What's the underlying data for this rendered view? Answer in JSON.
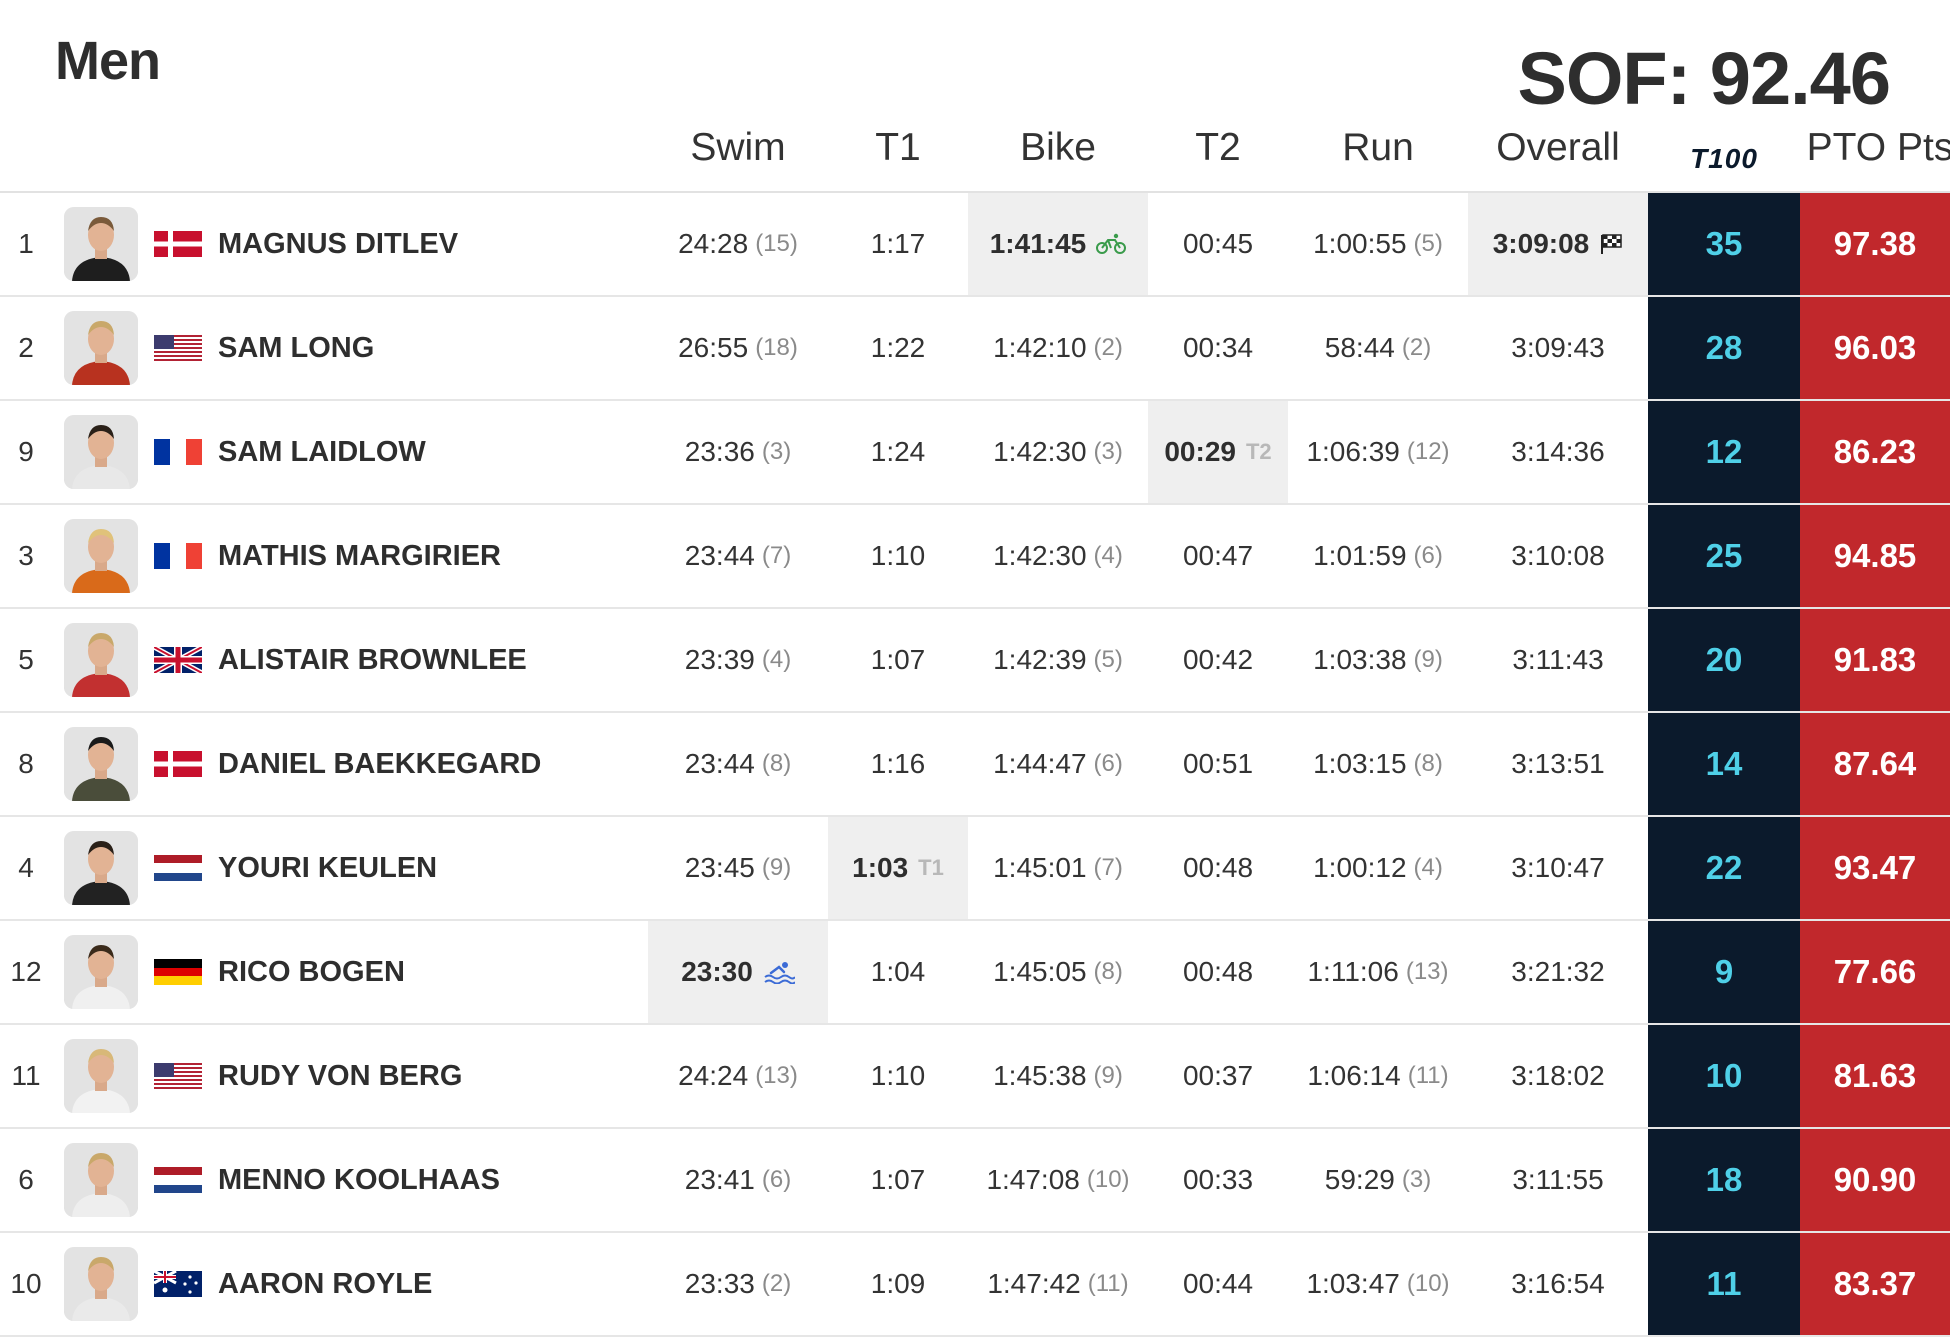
{
  "title": "Men",
  "sof": "SOF: 92.46",
  "headers": {
    "swim": "Swim",
    "t1": "T1",
    "bike": "Bike",
    "t2": "T2",
    "run": "Run",
    "overall": "Overall",
    "t100": "T100",
    "pto": "PTO Pts"
  },
  "colors": {
    "t100_bg": "#0b1a2c",
    "t100_text": "#4fd0e8",
    "pto_bg": "#c1282c",
    "best_bg": "#efefef",
    "bike_icon": "#3a9b4b",
    "swim_icon": "#3b6bd6"
  },
  "rows": [
    {
      "rank": "1",
      "name": "MAGNUS DITLEV",
      "flag": "denmark",
      "swim": "24:28",
      "swim_rank": "(15)",
      "t1": "1:17",
      "bike": "1:41:45",
      "bike_rank": "",
      "t2": "00:45",
      "run": "1:00:55",
      "run_rank": "(5)",
      "overall": "3:09:08",
      "t100": "35",
      "pto": "97.38",
      "best": "bike,overall"
    },
    {
      "rank": "2",
      "name": "SAM LONG",
      "flag": "usa",
      "swim": "26:55",
      "swim_rank": "(18)",
      "t1": "1:22",
      "bike": "1:42:10",
      "bike_rank": "(2)",
      "t2": "00:34",
      "run": "58:44",
      "run_rank": "(2)",
      "overall": "3:09:43",
      "t100": "28",
      "pto": "96.03",
      "best": ""
    },
    {
      "rank": "9",
      "name": "SAM LAIDLOW",
      "flag": "france",
      "swim": "23:36",
      "swim_rank": "(3)",
      "t1": "1:24",
      "bike": "1:42:30",
      "bike_rank": "(3)",
      "t2": "00:29",
      "t2_tag": "T2",
      "run": "1:06:39",
      "run_rank": "(12)",
      "overall": "3:14:36",
      "t100": "12",
      "pto": "86.23",
      "best": "t2"
    },
    {
      "rank": "3",
      "name": "MATHIS MARGIRIER",
      "flag": "france",
      "swim": "23:44",
      "swim_rank": "(7)",
      "t1": "1:10",
      "bike": "1:42:30",
      "bike_rank": "(4)",
      "t2": "00:47",
      "run": "1:01:59",
      "run_rank": "(6)",
      "overall": "3:10:08",
      "t100": "25",
      "pto": "94.85",
      "best": ""
    },
    {
      "rank": "5",
      "name": "ALISTAIR BROWNLEE",
      "flag": "uk",
      "swim": "23:39",
      "swim_rank": "(4)",
      "t1": "1:07",
      "bike": "1:42:39",
      "bike_rank": "(5)",
      "t2": "00:42",
      "run": "1:03:38",
      "run_rank": "(9)",
      "overall": "3:11:43",
      "t100": "20",
      "pto": "91.83",
      "best": ""
    },
    {
      "rank": "8",
      "name": "DANIEL BAEKKEGARD",
      "flag": "denmark",
      "swim": "23:44",
      "swim_rank": "(8)",
      "t1": "1:16",
      "bike": "1:44:47",
      "bike_rank": "(6)",
      "t2": "00:51",
      "run": "1:03:15",
      "run_rank": "(8)",
      "overall": "3:13:51",
      "t100": "14",
      "pto": "87.64",
      "best": ""
    },
    {
      "rank": "4",
      "name": "YOURI KEULEN",
      "flag": "netherlands",
      "swim": "23:45",
      "swim_rank": "(9)",
      "t1": "1:03",
      "t1_tag": "T1",
      "bike": "1:45:01",
      "bike_rank": "(7)",
      "t2": "00:48",
      "run": "1:00:12",
      "run_rank": "(4)",
      "overall": "3:10:47",
      "t100": "22",
      "pto": "93.47",
      "best": "t1"
    },
    {
      "rank": "12",
      "name": "RICO BOGEN",
      "flag": "germany",
      "swim": "23:30",
      "swim_rank": "",
      "t1": "1:04",
      "bike": "1:45:05",
      "bike_rank": "(8)",
      "t2": "00:48",
      "run": "1:11:06",
      "run_rank": "(13)",
      "overall": "3:21:32",
      "t100": "9",
      "pto": "77.66",
      "best": "swim"
    },
    {
      "rank": "11",
      "name": "RUDY VON BERG",
      "flag": "usa",
      "swim": "24:24",
      "swim_rank": "(13)",
      "t1": "1:10",
      "bike": "1:45:38",
      "bike_rank": "(9)",
      "t2": "00:37",
      "run": "1:06:14",
      "run_rank": "(11)",
      "overall": "3:18:02",
      "t100": "10",
      "pto": "81.63",
      "best": ""
    },
    {
      "rank": "6",
      "name": "MENNO KOOLHAAS",
      "flag": "netherlands",
      "swim": "23:41",
      "swim_rank": "(6)",
      "t1": "1:07",
      "bike": "1:47:08",
      "bike_rank": "(10)",
      "t2": "00:33",
      "run": "59:29",
      "run_rank": "(3)",
      "overall": "3:11:55",
      "t100": "18",
      "pto": "90.90",
      "best": ""
    },
    {
      "rank": "10",
      "name": "AARON ROYLE",
      "flag": "australia",
      "swim": "23:33",
      "swim_rank": "(2)",
      "t1": "1:09",
      "bike": "1:47:42",
      "bike_rank": "(11)",
      "t2": "00:44",
      "run": "1:03:47",
      "run_rank": "(10)",
      "overall": "3:16:54",
      "t100": "11",
      "pto": "83.37",
      "best": ""
    }
  ]
}
